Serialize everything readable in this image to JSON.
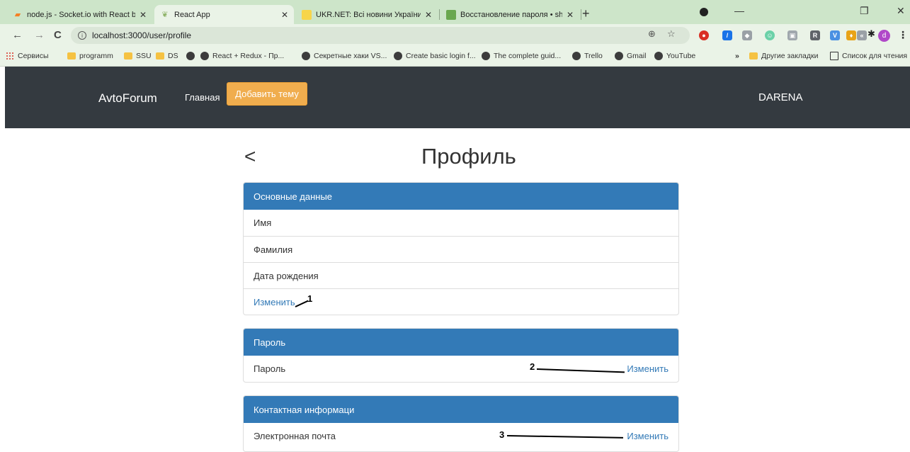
{
  "browser": {
    "tabs": [
      {
        "title": "node.js - Socket.io with React be",
        "favicon": "stackoverflow-icon"
      },
      {
        "title": "React App",
        "favicon": "react-icon"
      },
      {
        "title": "UKR.NET: Всі новини України, ос",
        "favicon": "ukrnet-icon"
      },
      {
        "title": "Восстановление пароля • shevd",
        "favicon": "mail-icon"
      }
    ],
    "new_tab": "+",
    "url": "localhost:3000/user/profile",
    "bookmarks": [
      {
        "label": "Сервисы",
        "icon": "apps-icon"
      },
      {
        "label": "programm",
        "icon": "folder-icon"
      },
      {
        "label": "SSU",
        "icon": "folder-icon"
      },
      {
        "label": "DS",
        "icon": "folder-icon"
      },
      {
        "label": "",
        "icon": "globe-icon"
      },
      {
        "label": "React + Redux - Пр...",
        "icon": "globe-icon"
      },
      {
        "label": "Секретные хаки VS...",
        "icon": "globe-icon"
      },
      {
        "label": "Create basic login f...",
        "icon": "globe-icon"
      },
      {
        "label": "The complete guid...",
        "icon": "globe-icon"
      },
      {
        "label": "Trello",
        "icon": "globe-icon"
      },
      {
        "label": "Gmail",
        "icon": "globe-icon"
      },
      {
        "label": "YouTube",
        "icon": "globe-icon"
      }
    ],
    "bookmarks_more": "»",
    "other_bookmarks": "Другие закладки",
    "reading_list": "Список для чтения",
    "profile_initial": "d"
  },
  "app": {
    "brand": "AvtoForum",
    "nav_home": "Главная",
    "add_topic": "Добавить тему",
    "user": "DARENA"
  },
  "page": {
    "back": "<",
    "title": "Профиль",
    "sections": {
      "basic": {
        "header": "Основные данные",
        "first_name": "Имя",
        "last_name": "Фамилия",
        "birth_date": "Дата рождения",
        "edit": "Изменить"
      },
      "password": {
        "header": "Пароль",
        "label": "Пароль",
        "edit": "Изменить"
      },
      "contact": {
        "header": "Контактная информаци",
        "email": "Электронная почта",
        "edit": "Изменить"
      }
    }
  },
  "annotations": [
    "1",
    "2",
    "3"
  ],
  "colors": {
    "tabstrip": "#cde5c9",
    "navbar": "#343a40",
    "panel_header": "#337ab7",
    "add_button": "#f0ad4e",
    "link": "#337ab7"
  }
}
